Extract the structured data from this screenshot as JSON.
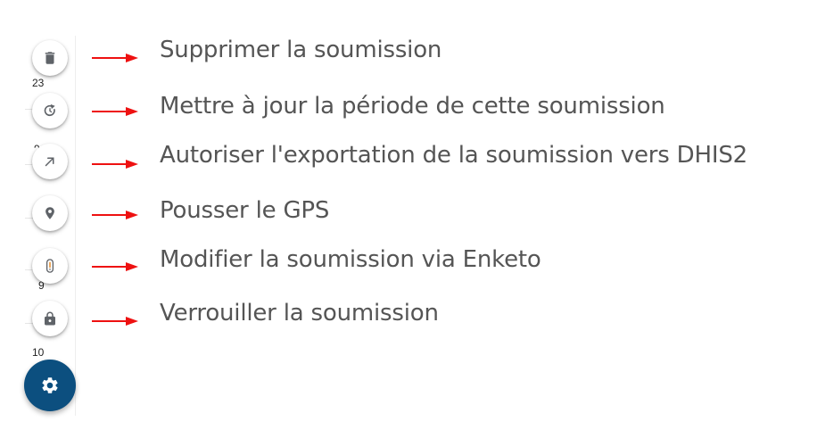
{
  "colors": {
    "arrow": "#ee1111",
    "label_text": "#555555",
    "icon": "#666666",
    "fab_main_bg": "#0c4f7f",
    "fab_main_icon": "#ffffff"
  },
  "background_numbers": [
    "23",
    "9",
    "9",
    "10"
  ],
  "actions": [
    {
      "icon": "delete-icon",
      "label": "Supprimer la soumission"
    },
    {
      "icon": "refresh-icon",
      "label": "Mettre à jour la période de  cette soumission"
    },
    {
      "icon": "export-arrow-icon",
      "label": "Autoriser l'exportation de la soumission vers DHIS2"
    },
    {
      "icon": "location-pin-icon",
      "label": "Pousser le GPS"
    },
    {
      "icon": "enketo-icon",
      "label": "Modifier la soumission via Enketo"
    },
    {
      "icon": "lock-icon",
      "label": "Verrouiller la soumission"
    }
  ],
  "main_button": {
    "icon": "settings-icon"
  }
}
